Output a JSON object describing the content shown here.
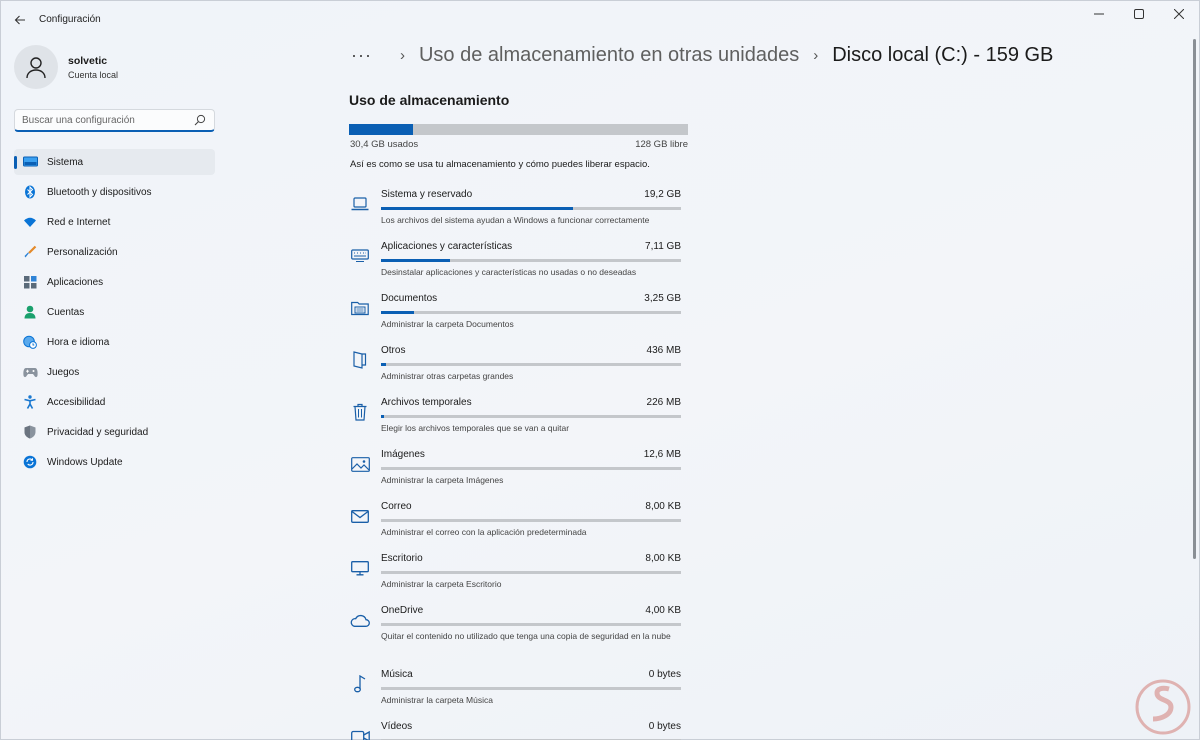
{
  "window": {
    "title": "Configuración"
  },
  "profile": {
    "name": "solvetic",
    "subtitle": "Cuenta local"
  },
  "search": {
    "placeholder": "Buscar una configuración"
  },
  "sidebar": {
    "items": [
      {
        "label": "Sistema",
        "icon": "monitor-icon",
        "color": "#0a74d6",
        "active": true
      },
      {
        "label": "Bluetooth y dispositivos",
        "icon": "bluetooth-icon",
        "color": "#0a74d6"
      },
      {
        "label": "Red e Internet",
        "icon": "wifi-icon",
        "color": "#0a74d6"
      },
      {
        "label": "Personalización",
        "icon": "brush-icon",
        "color": "#e48a2a"
      },
      {
        "label": "Aplicaciones",
        "icon": "apps-icon",
        "color": "#5a6a7a"
      },
      {
        "label": "Cuentas",
        "icon": "person-icon",
        "color": "#1aa06d"
      },
      {
        "label": "Hora e idioma",
        "icon": "globe-clock-icon",
        "color": "#0a74d6"
      },
      {
        "label": "Juegos",
        "icon": "gamepad-icon",
        "color": "#6b7480"
      },
      {
        "label": "Accesibilidad",
        "icon": "accessibility-icon",
        "color": "#1a78d0"
      },
      {
        "label": "Privacidad y seguridad",
        "icon": "shield-icon",
        "color": "#7b8490"
      },
      {
        "label": "Windows Update",
        "icon": "update-icon",
        "color": "#0a74d6"
      }
    ]
  },
  "breadcrumb": {
    "more": "···",
    "parent": "Uso de almacenamiento en otras unidades",
    "current": "Disco local (C:) - 159 GB"
  },
  "storage": {
    "title": "Uso de almacenamiento",
    "used_label": "30,4 GB usados",
    "free_label": "128 GB libre",
    "used_fraction": 0.19,
    "intro": "Así es como se usa tu almacenamiento y cómo puedes liberar espacio.",
    "categories": [
      {
        "name": "Sistema y reservado",
        "size": "19,2 GB",
        "fill": 0.64,
        "desc": "Los archivos del sistema ayudan a Windows a funcionar correctamente",
        "icon": "laptop-icon"
      },
      {
        "name": "Aplicaciones y características",
        "size": "7,11 GB",
        "fill": 0.23,
        "desc": "Desinstalar aplicaciones y características no usadas o no deseadas",
        "icon": "keyboard-icon"
      },
      {
        "name": "Documentos",
        "size": "3,25 GB",
        "fill": 0.11,
        "desc": "Administrar la carpeta Documentos",
        "icon": "folder-icon"
      },
      {
        "name": "Otros",
        "size": "436 MB",
        "fill": 0.015,
        "desc": "Administrar otras carpetas grandes",
        "icon": "folder-stack-icon"
      },
      {
        "name": "Archivos temporales",
        "size": "226 MB",
        "fill": 0.008,
        "desc": "Elegir los archivos temporales que se van a quitar",
        "icon": "trash-icon"
      },
      {
        "name": "Imágenes",
        "size": "12,6 MB",
        "fill": 0,
        "desc": "Administrar la carpeta Imágenes",
        "icon": "image-icon"
      },
      {
        "name": "Correo",
        "size": "8,00 KB",
        "fill": 0,
        "desc": "Administrar el correo con la aplicación predeterminada",
        "icon": "mail-icon"
      },
      {
        "name": "Escritorio",
        "size": "8,00 KB",
        "fill": 0,
        "desc": "Administrar la carpeta Escritorio",
        "icon": "desktop-icon"
      },
      {
        "name": "OneDrive",
        "size": "4,00 KB",
        "fill": 0,
        "desc": "Quitar el contenido no utilizado que tenga una copia de seguridad en la nube",
        "icon": "cloud-icon"
      },
      {
        "name": "Música",
        "size": "0 bytes",
        "fill": 0,
        "desc": "Administrar la carpeta Música",
        "icon": "music-icon"
      },
      {
        "name": "Vídeos",
        "size": "0 bytes",
        "fill": 0,
        "desc": "",
        "icon": "video-icon"
      }
    ]
  },
  "colors": {
    "accent": "#0a5fb4",
    "bar_track": "#c4c7cb"
  }
}
